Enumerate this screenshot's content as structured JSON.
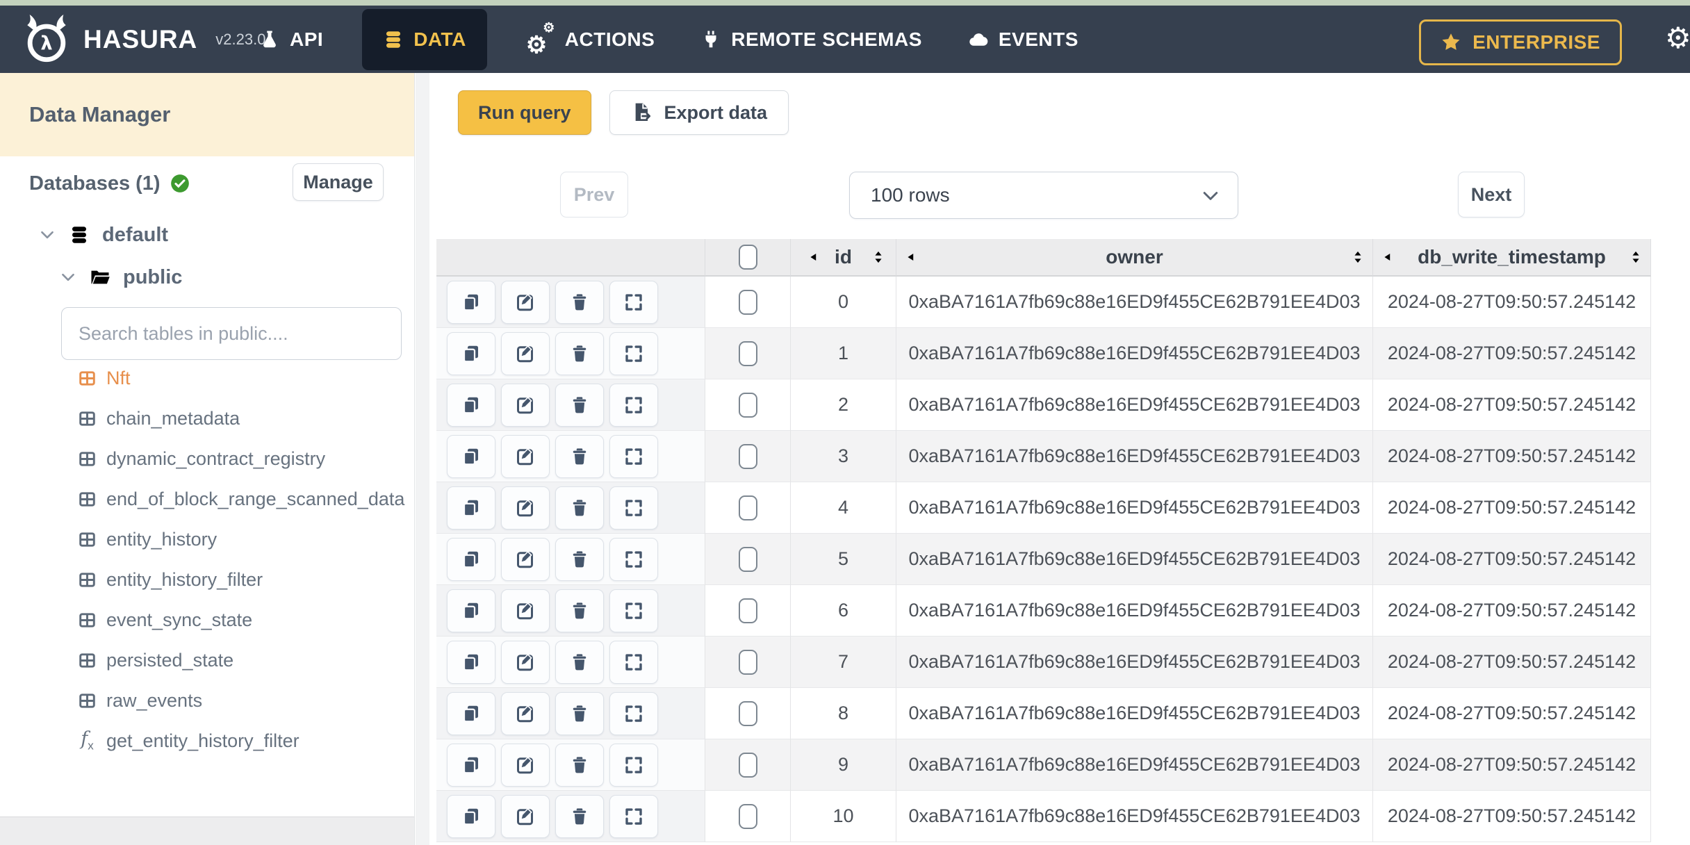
{
  "topbar": {
    "brand": "HASURA",
    "version": "v2.23.0",
    "nav": [
      {
        "label": "API",
        "icon": "flask-icon",
        "active": false
      },
      {
        "label": "DATA",
        "icon": "database-icon",
        "active": true
      },
      {
        "label": "ACTIONS",
        "icon": "gears-icon",
        "active": false
      },
      {
        "label": "REMOTE SCHEMAS",
        "icon": "plug-icon",
        "active": false
      },
      {
        "label": "EVENTS",
        "icon": "cloud-icon",
        "active": false
      }
    ],
    "enterprise_label": "ENTERPRISE",
    "colors": {
      "accent_yellow": "#f1c14d",
      "navbar_bg": "#36404f",
      "active_tab_bg": "#151d2a",
      "top_strip": "#c3d2bd"
    }
  },
  "sidebar": {
    "title": "Data Manager",
    "databases_label": "Databases (1)",
    "manage_button": "Manage",
    "tree": {
      "database": "default",
      "schema": "public"
    },
    "search_placeholder": "Search tables in public....",
    "tables": [
      {
        "name": "Nft",
        "active": true
      },
      {
        "name": "chain_metadata",
        "active": false
      },
      {
        "name": "dynamic_contract_registry",
        "active": false
      },
      {
        "name": "end_of_block_range_scanned_data",
        "active": false
      },
      {
        "name": "entity_history",
        "active": false
      },
      {
        "name": "entity_history_filter",
        "active": false
      },
      {
        "name": "event_sync_state",
        "active": false
      },
      {
        "name": "persisted_state",
        "active": false
      },
      {
        "name": "raw_events",
        "active": false
      }
    ],
    "function": "get_entity_history_filter",
    "colors": {
      "header_bg": "#fcf1d7",
      "active_table": "#e78f4c",
      "check_green": "#3d9a2f"
    }
  },
  "toolbar": {
    "run_query": "Run query",
    "export_data": "Export data"
  },
  "pagination": {
    "prev": "Prev",
    "rows_selected": "100 rows",
    "next": "Next"
  },
  "table": {
    "columns": [
      "id",
      "owner",
      "db_write_timestamp"
    ],
    "rows": [
      {
        "id": "0",
        "owner": "0xaBA7161A7fb69c88e16ED9f455CE62B791EE4D03",
        "db_write_timestamp": "2024-08-27T09:50:57.245142"
      },
      {
        "id": "1",
        "owner": "0xaBA7161A7fb69c88e16ED9f455CE62B791EE4D03",
        "db_write_timestamp": "2024-08-27T09:50:57.245142"
      },
      {
        "id": "2",
        "owner": "0xaBA7161A7fb69c88e16ED9f455CE62B791EE4D03",
        "db_write_timestamp": "2024-08-27T09:50:57.245142"
      },
      {
        "id": "3",
        "owner": "0xaBA7161A7fb69c88e16ED9f455CE62B791EE4D03",
        "db_write_timestamp": "2024-08-27T09:50:57.245142"
      },
      {
        "id": "4",
        "owner": "0xaBA7161A7fb69c88e16ED9f455CE62B791EE4D03",
        "db_write_timestamp": "2024-08-27T09:50:57.245142"
      },
      {
        "id": "5",
        "owner": "0xaBA7161A7fb69c88e16ED9f455CE62B791EE4D03",
        "db_write_timestamp": "2024-08-27T09:50:57.245142"
      },
      {
        "id": "6",
        "owner": "0xaBA7161A7fb69c88e16ED9f455CE62B791EE4D03",
        "db_write_timestamp": "2024-08-27T09:50:57.245142"
      },
      {
        "id": "7",
        "owner": "0xaBA7161A7fb69c88e16ED9f455CE62B791EE4D03",
        "db_write_timestamp": "2024-08-27T09:50:57.245142"
      },
      {
        "id": "8",
        "owner": "0xaBA7161A7fb69c88e16ED9f455CE62B791EE4D03",
        "db_write_timestamp": "2024-08-27T09:50:57.245142"
      },
      {
        "id": "9",
        "owner": "0xaBA7161A7fb69c88e16ED9f455CE62B791EE4D03",
        "db_write_timestamp": "2024-08-27T09:50:57.245142"
      },
      {
        "id": "10",
        "owner": "0xaBA7161A7fb69c88e16ED9f455CE62B791EE4D03",
        "db_write_timestamp": "2024-08-27T09:50:57.245142"
      }
    ]
  }
}
